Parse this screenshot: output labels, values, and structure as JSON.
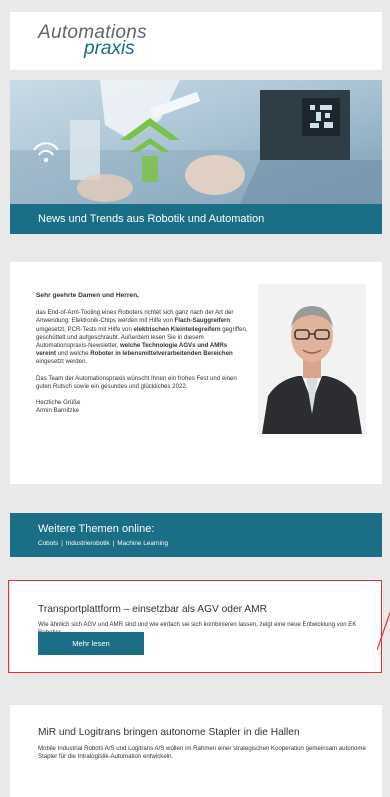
{
  "logo": {
    "line1": "Automations",
    "line2": "praxis"
  },
  "banner": {
    "title": "News und Trends aus Robotik und Automation"
  },
  "letter": {
    "greeting": "Sehr geehrte Damen und Herren,",
    "p1_a": "das End-of-Arm-Tooling eines Roboters richtet sich ganz nach der Art der Anwendung: Elektronik-Chips werden mit Hilfe von ",
    "p1_b1": "Flach-Sauggreifern",
    "p1_c": " umgesetzt, PCR-Tests mit Hilfe von ",
    "p1_b2": "elektrischen Kleinteilegreifern",
    "p1_d": " gegriffen, geschüttelt und aufgeschraubt. Außerdem lesen Sie in diesem Automationspraxis-Newsletter, ",
    "p1_b3": "welche Technologie AGVs und AMRs vereint",
    "p1_e": " und welche ",
    "p1_b4": "Roboter in lebensmittelverarbeitenden Bereichen",
    "p1_f": " eingesetzt werden.",
    "p2": "Das Team der Automationspraxis wünscht Ihnen ein frohes Fest und einen guten Rutsch sowie ein gesundes und glückliches 2022.",
    "closing": "Herzliche Grüße",
    "signature": "Armin Barnitzke"
  },
  "topics": {
    "heading": "Weitere Themen online:",
    "links": [
      "Cobots",
      "Industrierobotik",
      "Machine Learning"
    ]
  },
  "article1": {
    "title": "Transportplattform – einsetzbar als AGV oder AMR",
    "description": "Wie ähnlich sich AGV und AMR sind und wie einfach sie sich kombinieren lassen, zeigt eine neue Entwicklung von EK Robotics.",
    "button": "Mehr lesen"
  },
  "article2": {
    "title": "MiR und Logitrans bringen autonome Stapler in die Hallen",
    "description": "Mobile Industrial Robots A/S und Logitrans A/S wollen im Rahmen einer strategischen Kooperation gemeinsam autonome Stapler für die Intralogistik-Automation entwickeln."
  },
  "colors": {
    "brand": "#1a6e85",
    "highlight": "#e62e2e",
    "background": "#e9e9e9"
  }
}
